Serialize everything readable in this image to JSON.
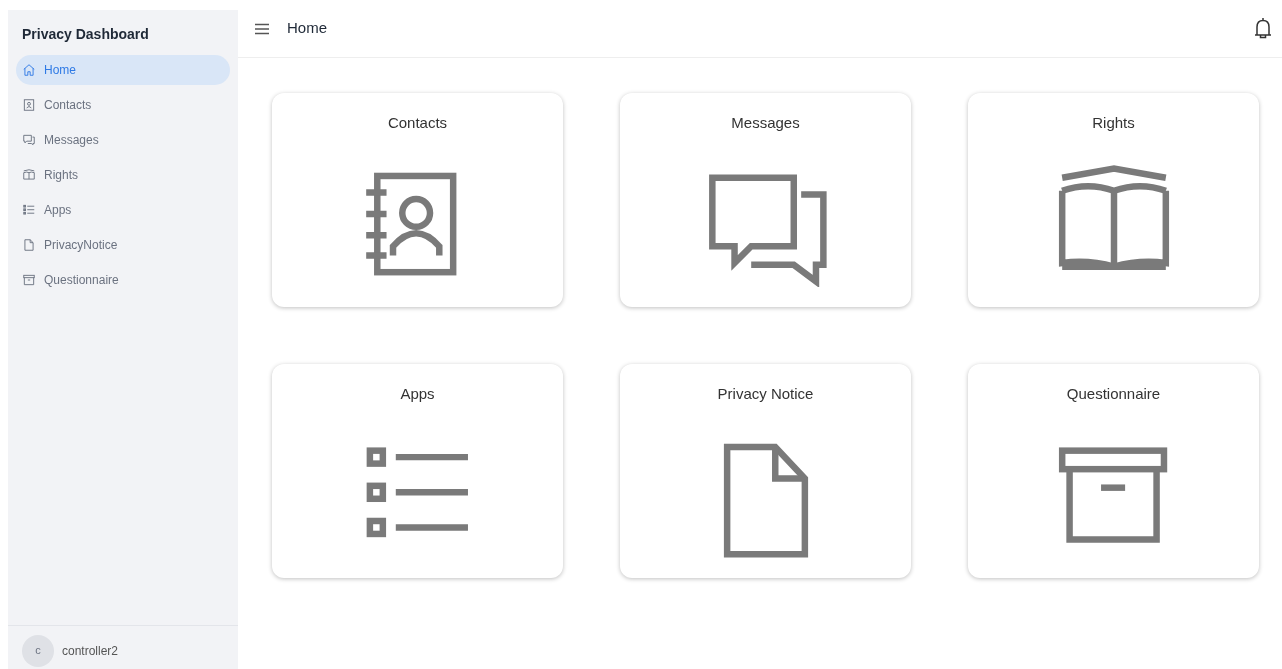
{
  "sidebar": {
    "title": "Privacy Dashboard",
    "items": [
      {
        "label": "Home",
        "selected": true
      },
      {
        "label": "Contacts",
        "selected": false
      },
      {
        "label": "Messages",
        "selected": false
      },
      {
        "label": "Rights",
        "selected": false
      },
      {
        "label": "Apps",
        "selected": false
      },
      {
        "label": "PrivacyNotice",
        "selected": false
      },
      {
        "label": "Questionnaire",
        "selected": false
      }
    ],
    "user": {
      "initial": "c",
      "name": "controller2"
    }
  },
  "header": {
    "title": "Home"
  },
  "cards": [
    {
      "title": "Contacts"
    },
    {
      "title": "Messages"
    },
    {
      "title": "Rights"
    },
    {
      "title": "Apps"
    },
    {
      "title": "Privacy Notice"
    },
    {
      "title": "Questionnaire"
    }
  ]
}
